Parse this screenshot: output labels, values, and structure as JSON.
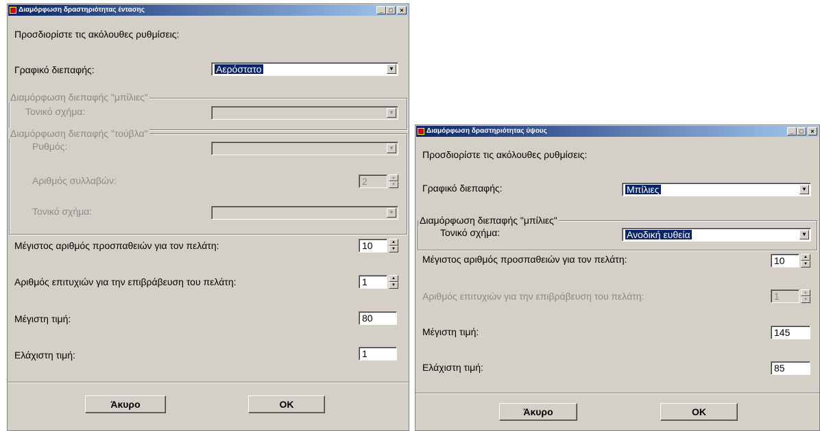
{
  "left_window": {
    "title": "Διαμόρφωση δραστηριότητας έντασης",
    "window_controls": {
      "minimize": "_",
      "maximize": "□",
      "close": "×"
    },
    "intro": "Προσδιορίστε τις ακόλουθες ρυθμίσεις:",
    "interface_label": "Γραφικό διεπαφής:",
    "interface_value": "Αερόστατο",
    "balloons_group": {
      "legend": "Διαμόρφωση διεπαφής \"μπίλιες\"",
      "tone_label": "Τονικό σχήμα:",
      "tone_value": ""
    },
    "bricks_group": {
      "legend": "Διαμόρφωση διεπαφής \"τούβλα\"",
      "rhythm_label": "Ρυθμός:",
      "rhythm_value": "",
      "syllables_label": "Αριθμός συλλαβών:",
      "syllables_value": "2",
      "tone_label": "Τονικό σχήμα:",
      "tone_value": ""
    },
    "max_attempts_label": "Μέγιστος αριθμός προσπαθειών για τον πελάτη:",
    "max_attempts_value": "10",
    "successes_label": "Αριθμός επιτυχιών για την επιβράβευση του πελάτη:",
    "successes_value": "1",
    "max_value_label": "Μέγιστη τιμή:",
    "max_value": "80",
    "min_value_label": "Ελάχιστη τιμή:",
    "min_value": "1",
    "cancel_label": "Άκυρο",
    "ok_label": "OK"
  },
  "right_window": {
    "title": "Διαμόρφωση δραστηριότητας ύψους",
    "window_controls": {
      "minimize": "_",
      "maximize": "□",
      "close": "×"
    },
    "intro": "Προσδιορίστε τις ακόλουθες ρυθμίσεις:",
    "interface_label": "Γραφικό διεπαφής:",
    "interface_value": "Μπίλιες",
    "balloons_group": {
      "legend": "Διαμόρφωση διεπαφής \"μπίλιες\"",
      "tone_label": "Τονικό σχήμα:",
      "tone_value": "Ανοδική ευθεία"
    },
    "max_attempts_label": "Μέγιστος αριθμός προσπαθειών για τον πελάτη:",
    "max_attempts_value": "10",
    "successes_label": "Αριθμός επιτυχιών για την επιβράβευση του πελάτη:",
    "successes_value": "1",
    "max_value_label": "Μέγιστη τιμή:",
    "max_value": "145",
    "min_value_label": "Ελάχιστη τιμή:",
    "min_value": "85",
    "cancel_label": "Άκυρο",
    "ok_label": "OK"
  },
  "colors": {
    "face": "#d4d0c8",
    "title_start": "#0a246a",
    "title_end": "#a6caf0",
    "selection": "#0a246a",
    "disabled_text": "#8a8a8a"
  },
  "icons": {
    "app": "app-icon",
    "dropdown": "chevron-down-icon",
    "spin_up": "spin-up-icon",
    "spin_down": "spin-down-icon"
  }
}
